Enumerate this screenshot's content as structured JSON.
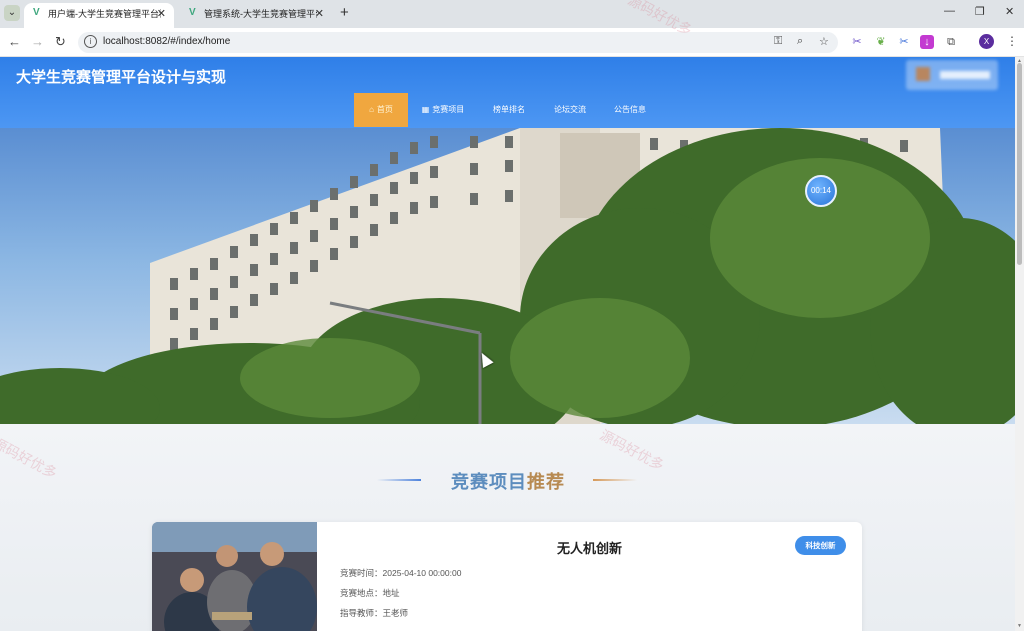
{
  "browser": {
    "tabs": [
      {
        "title": "用户端-大学生竞赛管理平台设计",
        "active": true
      },
      {
        "title": "管理系统-大学生竞赛管理平台设",
        "active": false
      }
    ],
    "url": "localhost:8082/#/index/home",
    "profile_initial": "X",
    "icons": [
      "back-icon",
      "forward-icon",
      "reload-icon",
      "key-icon",
      "zoom-icon",
      "star-icon",
      "extensions-icon",
      "menu-icon"
    ]
  },
  "site": {
    "title": "大学生竞赛管理平台设计与实现",
    "nav": [
      {
        "label": "首页",
        "icon": "home-icon",
        "active": true
      },
      {
        "label": "竞赛项目",
        "icon": "grid-icon",
        "active": false
      },
      {
        "label": "榜单排名",
        "active": false
      },
      {
        "label": "论坛交流",
        "active": false
      },
      {
        "label": "公告信息",
        "active": false
      }
    ]
  },
  "hero": {
    "timer": "00:14"
  },
  "section": {
    "title_part1": "竞赛项目",
    "title_part2": "推荐"
  },
  "card": {
    "title": "无人机创新",
    "tag": "科技创新",
    "time_label": "竞赛时间：",
    "time": "2025-04-10 00:00:00",
    "place_label": "竞赛地点：",
    "place": "地址",
    "teacher_label": "指导教师：",
    "teacher": "王老师"
  },
  "watermarks": [
    "源码好优多",
    "源码好优多",
    "源码好优多"
  ],
  "colors": {
    "header_blue": "#2f7fe8",
    "nav_active": "#f0a73f",
    "tag_blue": "#3f8ee9",
    "title_blue": "#5d8dbe",
    "title_gold": "#b78a52"
  }
}
